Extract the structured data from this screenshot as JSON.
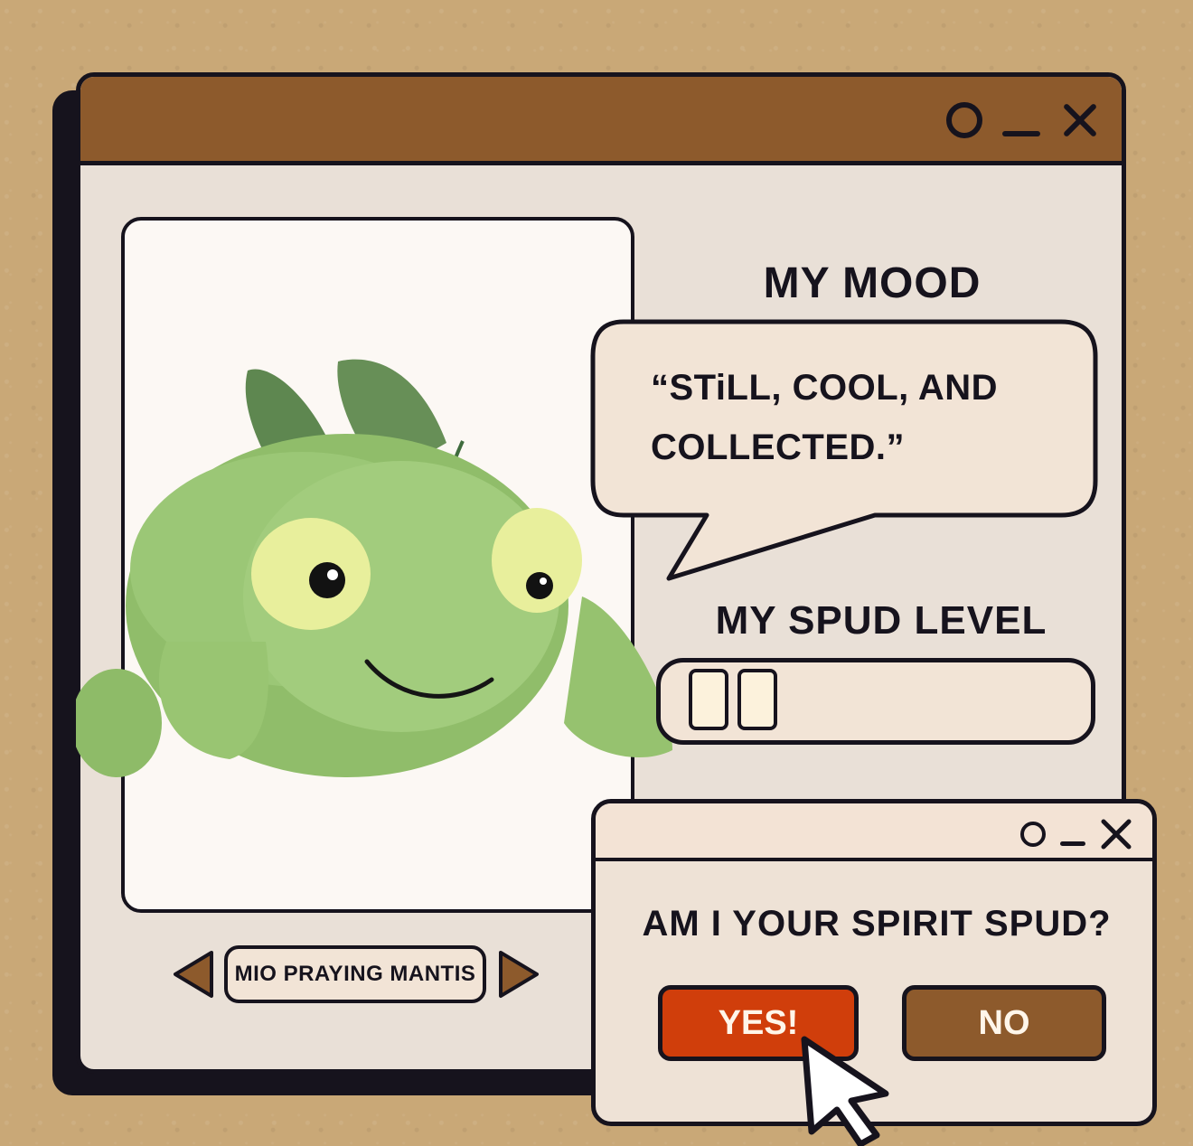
{
  "main_window": {
    "controls": [
      "circle-icon",
      "minimize-icon",
      "close-icon"
    ]
  },
  "product": {
    "name": "MIO PRAYING MANTIS",
    "image": "green-praying-mantis-plush",
    "prev_icon": "triangle-left-icon",
    "next_icon": "triangle-right-icon"
  },
  "mood": {
    "title": "MY MOOD",
    "quote_line1": "“STiLL, COOL, AND",
    "quote_line2": "COLLECTED.”"
  },
  "spud_level": {
    "title": "MY SPUD LEVEL",
    "filled_cells": 2,
    "level": 0.2
  },
  "dialog": {
    "controls": [
      "circle-icon",
      "minimize-icon",
      "close-icon"
    ],
    "question": "AM I YOUR SPIRIT SPUD?",
    "yes_label": "YES!",
    "no_label": "NO"
  },
  "colors": {
    "ink": "#16131d",
    "titlebar_brown": "#8d5a2c",
    "window_bg": "#e9e0d7",
    "yes_red": "#d03e0b",
    "background_kraft": "#c9a877"
  }
}
